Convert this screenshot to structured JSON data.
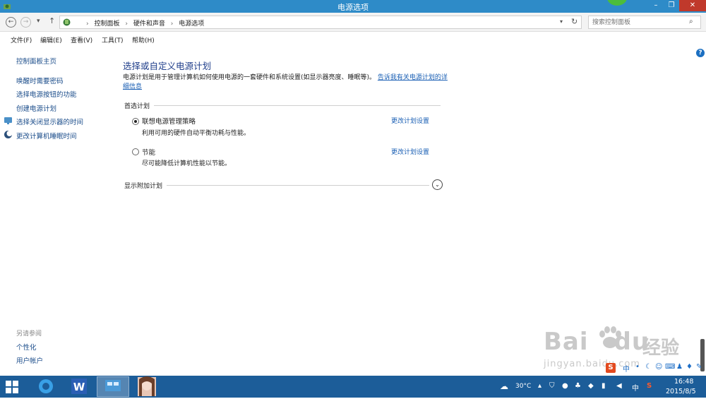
{
  "window": {
    "title": "电源选项",
    "minimize": "–",
    "maximize": "❐",
    "close": "✕"
  },
  "address": {
    "back_icon": "back-arrow-icon",
    "crumbs": [
      "控制面板",
      "硬件和声音",
      "电源选项"
    ],
    "search_placeholder": "搜索控制面板"
  },
  "menu": [
    "文件(F)",
    "编辑(E)",
    "查看(V)",
    "工具(T)",
    "帮助(H)"
  ],
  "sidebar": {
    "home": "控制面板主页",
    "links": [
      "唤醒时需要密码",
      "选择电源按钮的功能",
      "创建电源计划",
      "选择关闭显示器的时间",
      "更改计算机睡眠时间"
    ],
    "see_also_heading": "另请参阅",
    "see_also": [
      "个性化",
      "用户帐户"
    ]
  },
  "main": {
    "title": "选择或自定义电源计划",
    "description": "电源计划是用于管理计算机如何使用电源的一套硬件和系统设置(如显示器亮度、睡眠等)。",
    "description_link": "告诉我有关电源计划的详细信息",
    "preferred_label": "首选计划",
    "plans": [
      {
        "name": "联想电源管理策略",
        "desc": "利用可用的硬件自动平衡功耗与性能。",
        "link": "更改计划设置",
        "selected": true
      },
      {
        "name": "节能",
        "desc": "尽可能降低计算机性能以节能。",
        "link": "更改计划设置",
        "selected": false
      }
    ],
    "more_label": "显示附加计划"
  },
  "watermark": {
    "main": "Bai",
    "main2": "du",
    "cn": "经验",
    "sub": "jingyan.baidu.com"
  },
  "taskbar": {
    "temperature": "30°C",
    "ime_cn": "中",
    "time": "16:48",
    "date": "2015/8/5"
  },
  "ime_toolbar": {
    "logo": "S",
    "mode": "中"
  },
  "colors": {
    "titlebar": "#2e8bc8",
    "taskbar": "#1c5d99",
    "link": "#1a5fb4",
    "heading": "#1e3d8a"
  }
}
